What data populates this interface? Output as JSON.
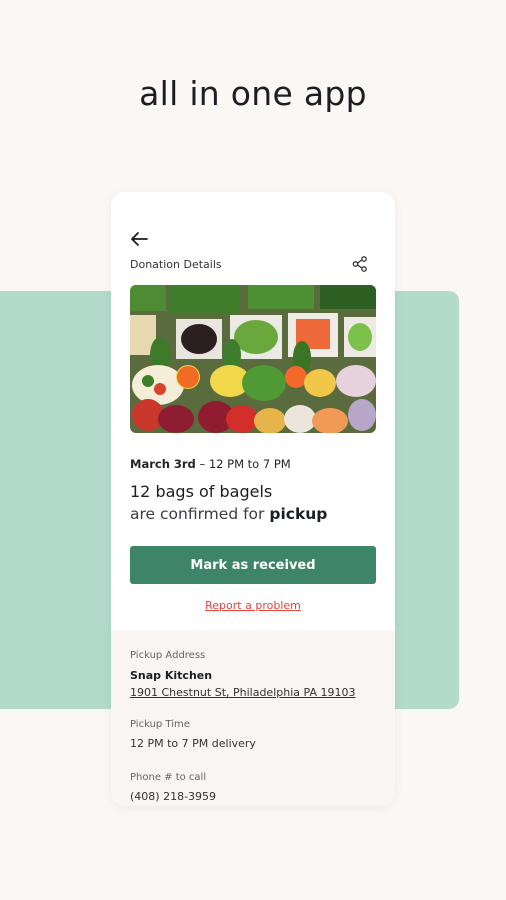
{
  "headline": "all in one app",
  "screen": {
    "title": "Donation Details",
    "date": "March 3rd",
    "time_window": "12 PM to 7 PM",
    "quantity_text": "12 bags of bagels",
    "status_prefix": "are confirmed for",
    "status_emphasis": "pickup",
    "primary_button": "Mark as received",
    "report_link": "Report a problem"
  },
  "details": {
    "pickup_address_label": "Pickup Address",
    "pickup_name": "Snap Kitchen",
    "pickup_address": "1901 Chestnut St, Philadelphia PA 19103",
    "pickup_time_label": "Pickup Time",
    "pickup_time": "12 PM to 7 PM delivery",
    "phone_label": "Phone # to call",
    "phone": "(408) 218-3959"
  },
  "icons": {
    "back": "arrow-left-icon",
    "share": "share-icon"
  },
  "colors": {
    "page_background": "#faf7f5",
    "mint": "#b2dbcb",
    "primary": "#3d8468",
    "danger_link": "#e0443c"
  }
}
